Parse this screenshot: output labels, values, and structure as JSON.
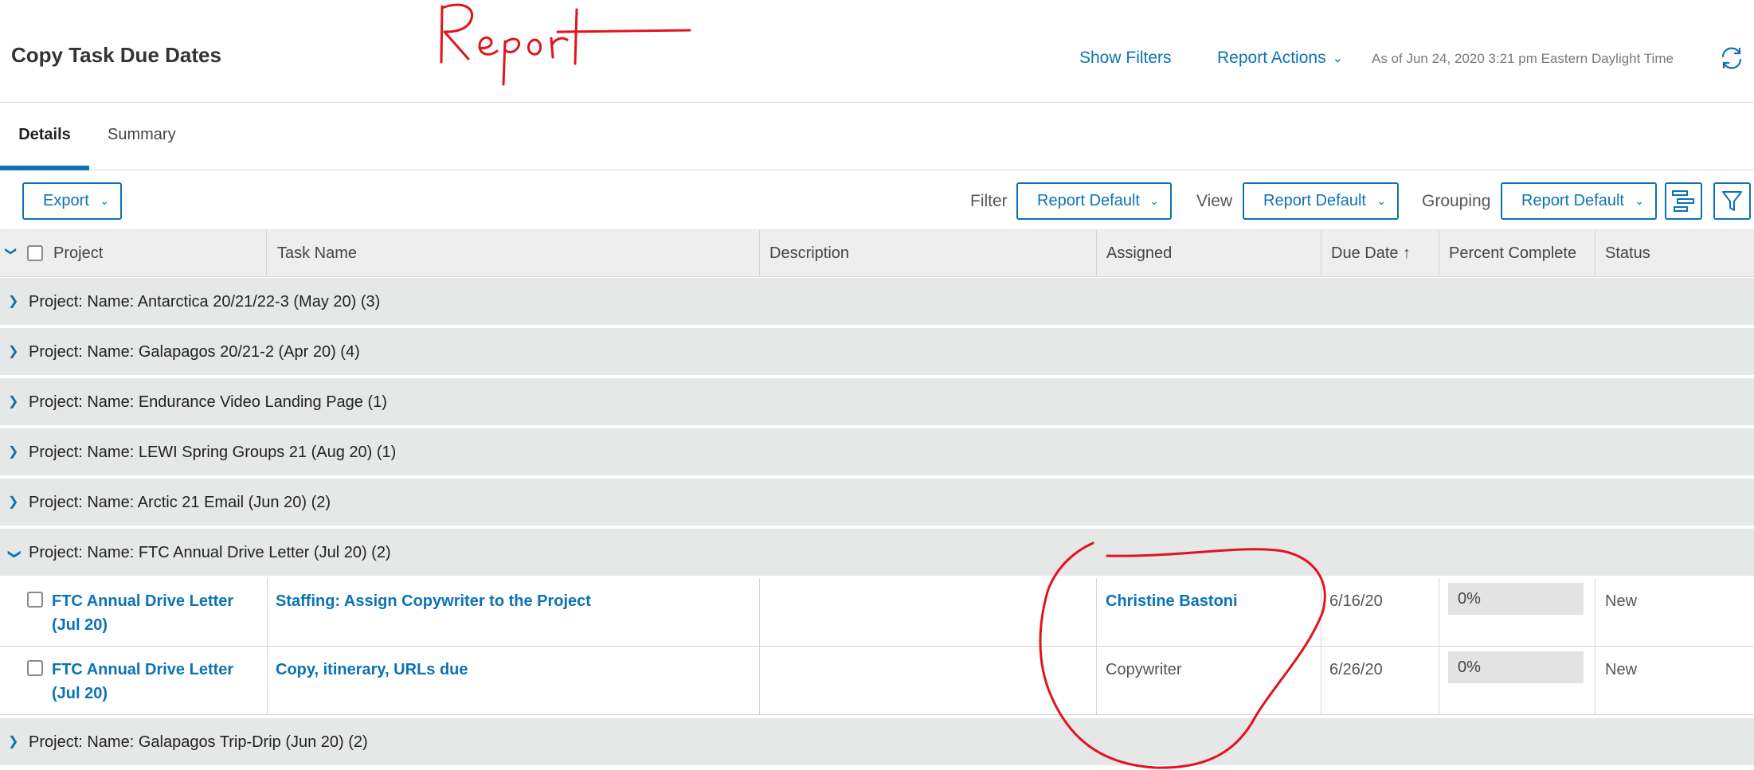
{
  "header": {
    "title": "Copy Task Due Dates",
    "show_filters": "Show Filters",
    "report_actions": "Report Actions",
    "as_of": "As of Jun 24, 2020 3:21 pm Eastern Daylight Time"
  },
  "annotation": {
    "handwritten": "Report",
    "color": "#e0141e"
  },
  "tabs": [
    {
      "label": "Details",
      "active": true
    },
    {
      "label": "Summary",
      "active": false
    }
  ],
  "toolbar": {
    "export": "Export",
    "filter_label": "Filter",
    "filter_value": "Report Default",
    "view_label": "View",
    "view_value": "Report Default",
    "grouping_label": "Grouping",
    "grouping_value": "Report Default"
  },
  "columns": {
    "project": "Project",
    "task_name": "Task Name",
    "description": "Description",
    "assigned": "Assigned",
    "due_date": "Due Date ↑",
    "percent_complete": "Percent Complete",
    "status": "Status"
  },
  "groups_before": [
    "Project: Name: Antarctica 20/21/22-3 (May 20) (3)",
    "Project: Name: Galapagos 20/21-2 (Apr 20) (4)",
    "Project: Name: Endurance Video Landing Page (1)",
    "Project: Name: LEWI Spring Groups 21 (Aug 20) (1)",
    "Project: Name: Arctic 21 Email (Jun 20) (2)"
  ],
  "expanded_group": "Project: Name: FTC Annual Drive Letter (Jul 20) (2)",
  "rows": [
    {
      "project_line1": "FTC Annual Drive Letter",
      "project_line2": "(Jul 20)",
      "task": "Staffing: Assign Copywriter to the Project",
      "description": "",
      "assigned": "Christine Bastoni",
      "due_date": "6/16/20",
      "percent": "0%",
      "status": "New"
    },
    {
      "project_line1": "FTC Annual Drive Letter",
      "project_line2": "(Jul 20)",
      "task": "Copy, itinerary, URLs due",
      "description": "",
      "assigned": "Copywriter",
      "due_date": "6/26/20",
      "percent": "0%",
      "status": "New"
    }
  ],
  "group_after": "Project: Name: Galapagos Trip-Drip (Jun 20) (2)",
  "colors": {
    "accent": "#0b73b5",
    "group_bg": "#e6e7e7",
    "annotation": "#e0141e"
  }
}
